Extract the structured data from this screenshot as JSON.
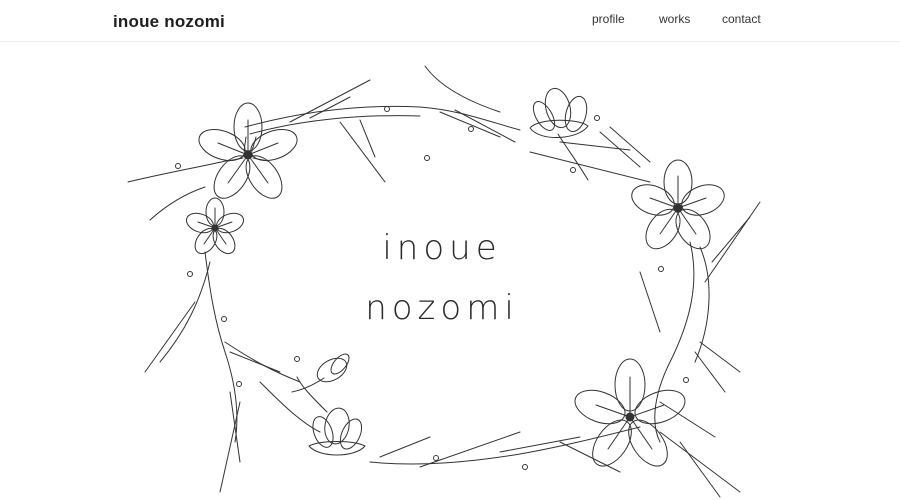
{
  "header": {
    "site_title": "inoue nozomi",
    "nav": [
      {
        "label": "profile"
      },
      {
        "label": "works"
      },
      {
        "label": "contact"
      }
    ]
  },
  "hero": {
    "title_line1": "inoue",
    "title_line2": "nozomi",
    "illustration": "floral-wreath-line-drawing"
  },
  "colors": {
    "background": "#ffffff",
    "text": "#222222",
    "line": "#333333"
  }
}
